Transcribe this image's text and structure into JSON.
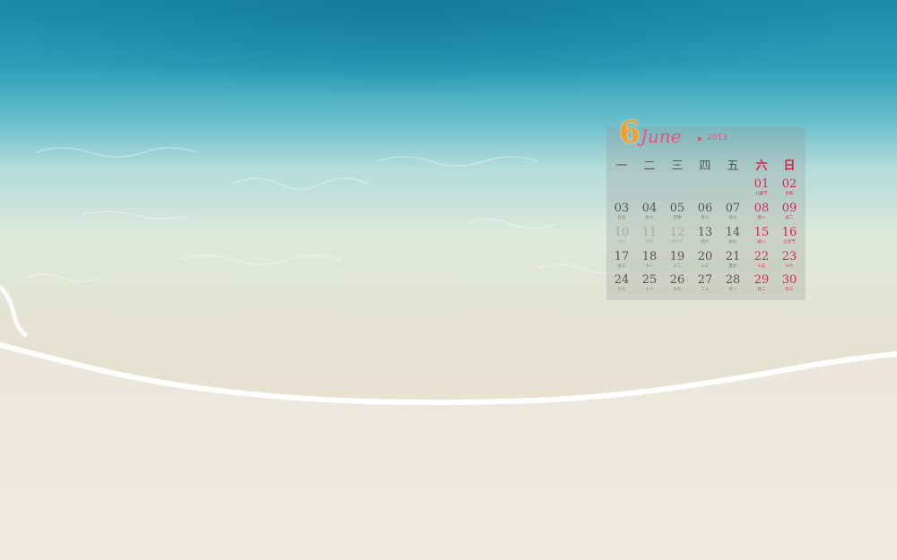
{
  "calendar": {
    "month_number": "6",
    "month_name": "June",
    "separator": ".",
    "year": "2013",
    "weekdays": [
      "一",
      "二",
      "三",
      "四",
      "五",
      "六",
      "日"
    ],
    "days": [
      {
        "n": "01",
        "l": "儿童节",
        "col": 5,
        "row": 0
      },
      {
        "n": "02",
        "l": "廿四",
        "col": 6,
        "row": 0
      },
      {
        "n": "03",
        "l": "廿五",
        "col": 0,
        "row": 1
      },
      {
        "n": "04",
        "l": "廿六",
        "col": 1,
        "row": 1
      },
      {
        "n": "05",
        "l": "芒种",
        "col": 2,
        "row": 1
      },
      {
        "n": "06",
        "l": "廿八",
        "col": 3,
        "row": 1
      },
      {
        "n": "07",
        "l": "廿九",
        "col": 4,
        "row": 1
      },
      {
        "n": "08",
        "l": "初一",
        "col": 5,
        "row": 1
      },
      {
        "n": "09",
        "l": "初二",
        "col": 6,
        "row": 1
      },
      {
        "n": "10",
        "l": "初三",
        "col": 0,
        "row": 2,
        "faded": true
      },
      {
        "n": "11",
        "l": "初四",
        "col": 1,
        "row": 2,
        "faded": true
      },
      {
        "n": "12",
        "l": "端午节",
        "col": 2,
        "row": 2,
        "faded": true
      },
      {
        "n": "13",
        "l": "初六",
        "col": 3,
        "row": 2
      },
      {
        "n": "14",
        "l": "初七",
        "col": 4,
        "row": 2
      },
      {
        "n": "15",
        "l": "初八",
        "col": 5,
        "row": 2
      },
      {
        "n": "16",
        "l": "父亲节",
        "col": 6,
        "row": 2
      },
      {
        "n": "17",
        "l": "初十",
        "col": 0,
        "row": 3
      },
      {
        "n": "18",
        "l": "十一",
        "col": 1,
        "row": 3
      },
      {
        "n": "19",
        "l": "十二",
        "col": 2,
        "row": 3
      },
      {
        "n": "20",
        "l": "十三",
        "col": 3,
        "row": 3
      },
      {
        "n": "21",
        "l": "夏至",
        "col": 4,
        "row": 3
      },
      {
        "n": "22",
        "l": "十五",
        "col": 5,
        "row": 3
      },
      {
        "n": "23",
        "l": "十六",
        "col": 6,
        "row": 3
      },
      {
        "n": "24",
        "l": "十七",
        "col": 0,
        "row": 4
      },
      {
        "n": "25",
        "l": "十八",
        "col": 1,
        "row": 4
      },
      {
        "n": "26",
        "l": "十九",
        "col": 2,
        "row": 4
      },
      {
        "n": "27",
        "l": "二十",
        "col": 3,
        "row": 4
      },
      {
        "n": "28",
        "l": "廿一",
        "col": 4,
        "row": 4
      },
      {
        "n": "29",
        "l": "廿二",
        "col": 5,
        "row": 4
      },
      {
        "n": "30",
        "l": "廿三",
        "col": 6,
        "row": 4
      }
    ]
  }
}
